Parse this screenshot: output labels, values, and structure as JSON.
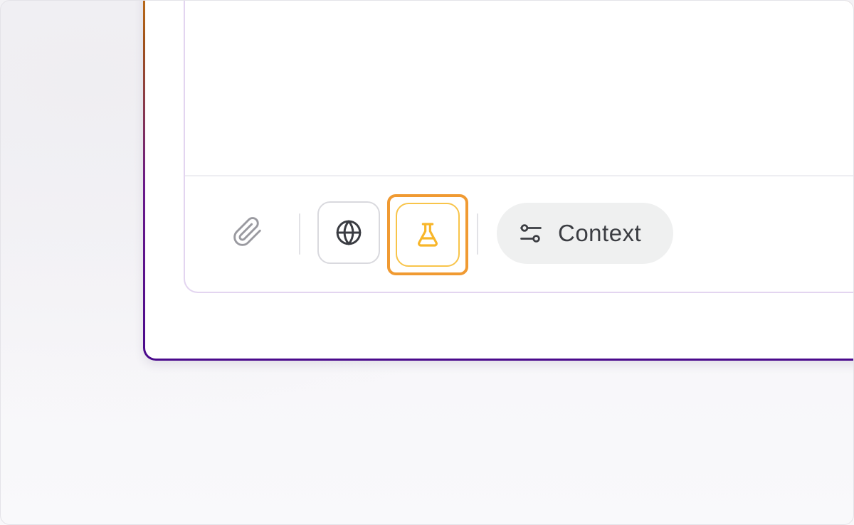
{
  "composer": {
    "toolbar": {
      "attach": {
        "icon": "paperclip-icon"
      },
      "web_search": {
        "icon": "globe-icon"
      },
      "research": {
        "icon": "flask-icon",
        "active_color": "#f8b62a"
      },
      "context": {
        "icon": "sliders-icon",
        "label": "Context"
      }
    }
  },
  "colors": {
    "highlight": "#f09a32",
    "composer_border": "#e3d5f0",
    "card_border_top": "#c97a1a",
    "card_border_bottom": "#4a0a8c"
  }
}
